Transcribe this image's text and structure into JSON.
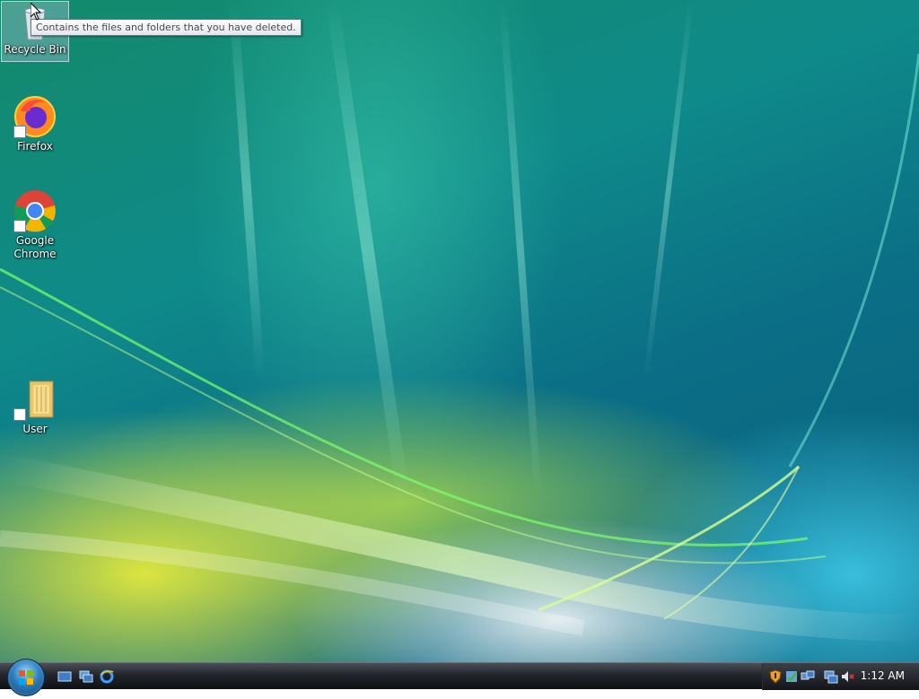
{
  "desktop": {
    "icons": [
      {
        "label": "Recycle Bin"
      },
      {
        "label": "Firefox"
      },
      {
        "label": "Google Chrome"
      },
      {
        "label": "User"
      }
    ],
    "tooltip": "Contains the files and folders that you have deleted."
  },
  "taskbar": {
    "clock": "1:12 AM"
  },
  "colors": {
    "taskbar": "#22262c",
    "desktop_base": "#0f8a8a"
  }
}
